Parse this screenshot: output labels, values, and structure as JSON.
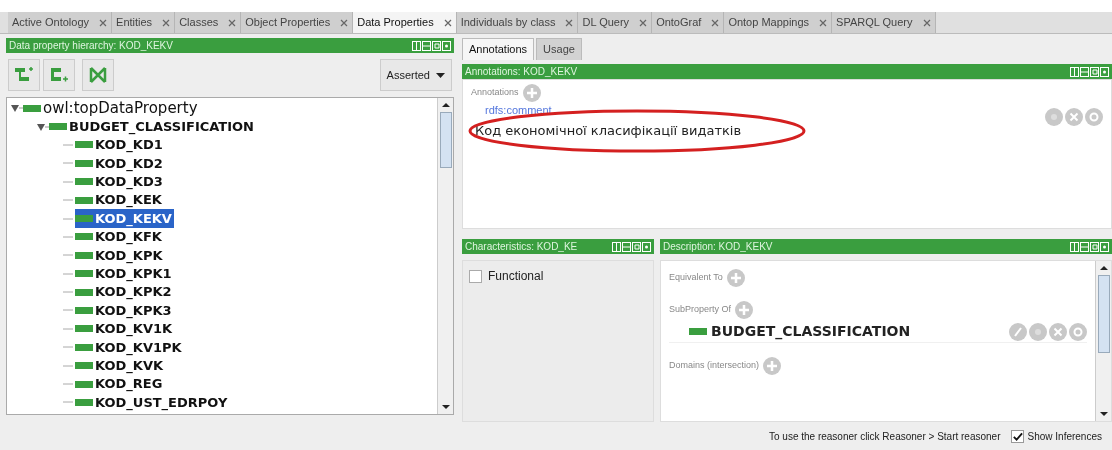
{
  "tabs": [
    {
      "label": "Active Ontology",
      "selected": false
    },
    {
      "label": "Entities",
      "selected": false
    },
    {
      "label": "Classes",
      "selected": false
    },
    {
      "label": "Object Properties",
      "selected": false
    },
    {
      "label": "Data Properties",
      "selected": true
    },
    {
      "label": "Individuals by class",
      "selected": false
    },
    {
      "label": "DL Query",
      "selected": false
    },
    {
      "label": "OntoGraf",
      "selected": false
    },
    {
      "label": "Ontop Mappings",
      "selected": false
    },
    {
      "label": "SPARQL Query",
      "selected": false
    }
  ],
  "hierarchy": {
    "title": "Data property hierarchy: KOD_KEKV",
    "mode": "Asserted",
    "tree": [
      {
        "label": "owl:topDataProperty",
        "expanded": true,
        "selected": false,
        "children": [
          {
            "label": "BUDGET_CLASSIFICATION",
            "expanded": true,
            "selected": false,
            "children": [
              {
                "label": "KOD_KD1",
                "selected": false
              },
              {
                "label": "KOD_KD2",
                "selected": false
              },
              {
                "label": "KOD_KD3",
                "selected": false
              },
              {
                "label": "KOD_KEK",
                "selected": false
              },
              {
                "label": "KOD_KEKV",
                "selected": true
              },
              {
                "label": "KOD_KFK",
                "selected": false
              },
              {
                "label": "KOD_KPK",
                "selected": false
              },
              {
                "label": "KOD_KPK1",
                "selected": false
              },
              {
                "label": "KOD_KPK2",
                "selected": false
              },
              {
                "label": "KOD_KPK3",
                "selected": false
              },
              {
                "label": "KOD_KV1K",
                "selected": false
              },
              {
                "label": "KOD_KV1PK",
                "selected": false
              },
              {
                "label": "KOD_KVK",
                "selected": false
              },
              {
                "label": "KOD_REG",
                "selected": false
              },
              {
                "label": "KOD_UST_EDRPOY",
                "selected": false
              }
            ]
          }
        ]
      }
    ]
  },
  "entity_tabs": [
    {
      "label": "Annotations",
      "selected": true
    },
    {
      "label": "Usage",
      "selected": false
    }
  ],
  "annotations": {
    "title": "Annotations: KOD_KEKV",
    "section_label": "Annotations",
    "items": [
      {
        "property": "rdfs:comment",
        "value": "Код економічної класифікації видатків",
        "highlighted": true
      }
    ]
  },
  "characteristics": {
    "title": "Characteristics: KOD_KE",
    "items": [
      {
        "label": "Functional",
        "checked": false
      }
    ]
  },
  "description": {
    "title": "Description: KOD_KEKV",
    "sections": [
      {
        "label": "Equivalent To"
      },
      {
        "label": "SubProperty Of",
        "items": [
          "BUDGET_CLASSIFICATION"
        ]
      },
      {
        "label": "Domains (intersection)"
      }
    ]
  },
  "status_bar": {
    "message": "To use the reasoner click Reasoner > Start reasoner",
    "show_inferences": {
      "label": "Show Inferences",
      "checked": true
    }
  }
}
